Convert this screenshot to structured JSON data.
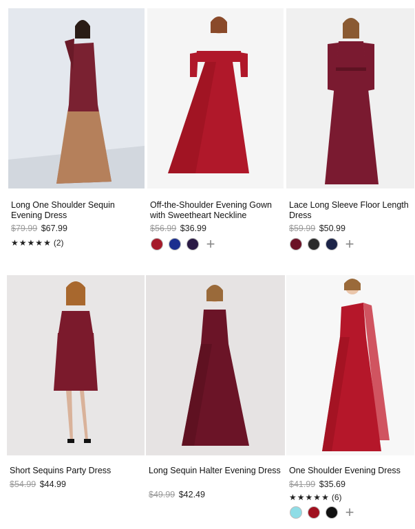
{
  "products": [
    {
      "title": "Long One Shoulder Sequin Evening Dress",
      "old_price": "$79.99",
      "price": "$67.99",
      "stars": 5,
      "reviews": "(2)",
      "swatches": [],
      "bg": "#e8ebef",
      "dress": "#7a2131",
      "accent": "#c9a06a"
    },
    {
      "title": "Off-the-Shoulder Evening Gown with Sweetheart Neckline",
      "old_price": "$56.99",
      "price": "$36.99",
      "stars": 0,
      "reviews": "",
      "swatches": [
        "#a51a2a",
        "#1b2f8f",
        "#2a1a45"
      ],
      "bg": "#f4f4f4",
      "dress": "#b0182a",
      "accent": "#b0182a"
    },
    {
      "title": "Lace Long Sleeve Floor Length Dress",
      "old_price": "$59.99",
      "price": "$50.99",
      "stars": 0,
      "reviews": "",
      "swatches": [
        "#6b1126",
        "#2b2b2b",
        "#1c2448"
      ],
      "bg": "#f1f1f1",
      "dress": "#7a1a30",
      "accent": "#7a1a30"
    },
    {
      "title": "Short Sequins Party Dress",
      "old_price": "$54.99",
      "price": "$44.99",
      "stars": 0,
      "reviews": "",
      "swatches": [],
      "bg": "#e9e6e6",
      "dress": "#7b1a2c",
      "accent": "#7b1a2c"
    },
    {
      "title": "Long Sequin Halter Evening Dress",
      "old_price": "$49.99",
      "price": "$42.49",
      "stars": 0,
      "reviews": "",
      "swatches": [],
      "bg": "#e8e5e5",
      "dress": "#6b1427",
      "accent": "#6b1427"
    },
    {
      "title": "One Shoulder Evening Dress",
      "old_price": "$41.99",
      "price": "$35.69",
      "stars": 5,
      "reviews": "(6)",
      "swatches": [
        "#8fdde6",
        "#a0101e",
        "#111111"
      ],
      "bg": "#f7f7f7",
      "dress": "#b5172a",
      "accent": "#b5172a"
    }
  ],
  "icons": {
    "star": "star-icon",
    "plus": "plus-icon",
    "rating_star": "★"
  }
}
